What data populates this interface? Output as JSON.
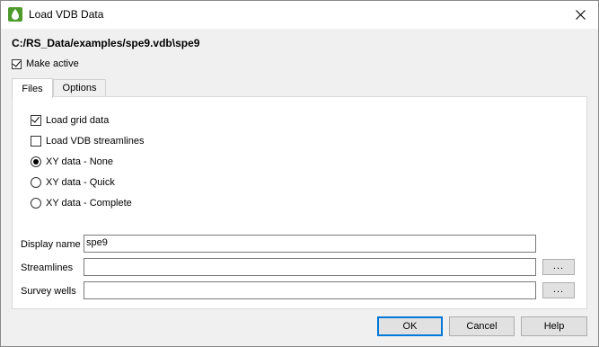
{
  "window": {
    "title": "Load VDB Data",
    "brand_color": "#4f9a2c",
    "close_icon": "close-icon"
  },
  "file_path": "C:/RS_Data/examples/spe9.vdb\\spe9",
  "make_active": {
    "label": "Make active",
    "checked": true
  },
  "tabs": [
    {
      "label": "Files",
      "active": true
    },
    {
      "label": "Options",
      "active": false
    }
  ],
  "files_tab": {
    "load_grid_data": {
      "label": "Load grid data",
      "checked": true
    },
    "load_vdb_streamlines": {
      "label": "Load VDB streamlines",
      "checked": false
    },
    "xy_options": [
      {
        "label": "XY data - None",
        "selected": true
      },
      {
        "label": "XY data - Quick",
        "selected": false
      },
      {
        "label": "XY data - Complete",
        "selected": false
      }
    ],
    "display_name": {
      "label": "Display name",
      "value": "spe9"
    },
    "streamlines": {
      "label": "Streamlines",
      "value": "",
      "browse_label": "..."
    },
    "survey_wells": {
      "label": "Survey wells",
      "value": "",
      "browse_label": "..."
    }
  },
  "buttons": {
    "ok": "OK",
    "cancel": "Cancel",
    "help": "Help"
  }
}
